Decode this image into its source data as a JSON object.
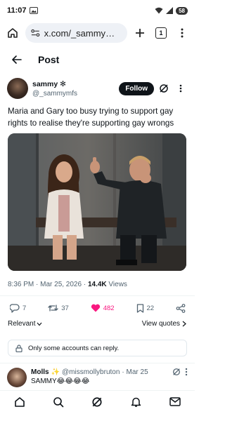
{
  "status_bar": {
    "time": "11:07",
    "battery": "58"
  },
  "browser": {
    "url": "x.com/_sammymfs/st",
    "tab_count": "1"
  },
  "header": {
    "title": "Post"
  },
  "author": {
    "display_name": "sammy",
    "badge": "✻",
    "handle": "@_sammymfs",
    "follow_label": "Follow"
  },
  "tweet": {
    "text": "Maria and Gary too busy trying to support gay rights to realise they're supporting gay wrongs"
  },
  "meta": {
    "time": "8:36 PM · Mar 25, 2026 · ",
    "views": "14.4K",
    "views_label": " Views"
  },
  "actions": {
    "replies": "7",
    "reposts": "37",
    "likes": "482",
    "bookmarks": "22"
  },
  "sort": {
    "label": "Relevant",
    "view_quotes": "View quotes"
  },
  "restriction": {
    "text": "Only some accounts can reply."
  },
  "reply": {
    "name": "Molls",
    "emoji": "✨",
    "handle": "@missmollybruton",
    "date": "· Mar 25",
    "text": "SAMMY😂😂😂😂"
  },
  "colors": {
    "like": "#f91880",
    "text": "#0f1419",
    "muted": "#536471"
  }
}
